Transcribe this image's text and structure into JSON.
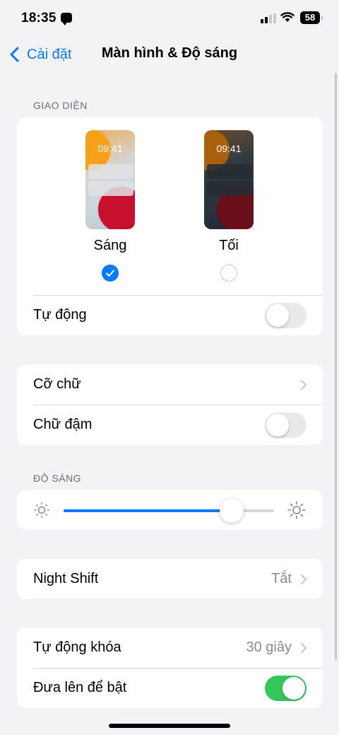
{
  "status_bar": {
    "time": "18:35",
    "battery": "58",
    "icons": [
      "message-icon",
      "cellular-signal-icon",
      "wifi-icon",
      "battery-icon"
    ]
  },
  "nav": {
    "back_label": "Cài đặt",
    "title": "Màn hình & Độ sáng"
  },
  "appearance": {
    "header": "GIAO DIỆN",
    "preview_time": "09:41",
    "light_label": "Sáng",
    "dark_label": "Tối",
    "selected": "light",
    "auto_label": "Tự động",
    "auto_enabled": false
  },
  "text": {
    "text_size_label": "Cỡ chữ",
    "bold_text_label": "Chữ đậm",
    "bold_text_enabled": false
  },
  "brightness": {
    "header": "ĐỘ SÁNG",
    "level_percent": 80
  },
  "night_shift": {
    "label": "Night Shift",
    "value": "Tắt"
  },
  "lock": {
    "auto_lock_label": "Tự động khóa",
    "auto_lock_value": "30 giây",
    "raise_to_wake_label": "Đưa lên để bật",
    "raise_to_wake_enabled": true
  },
  "colors": {
    "accent": "#007aff",
    "toggle_on": "#34c759",
    "background": "#f2f2f7"
  }
}
